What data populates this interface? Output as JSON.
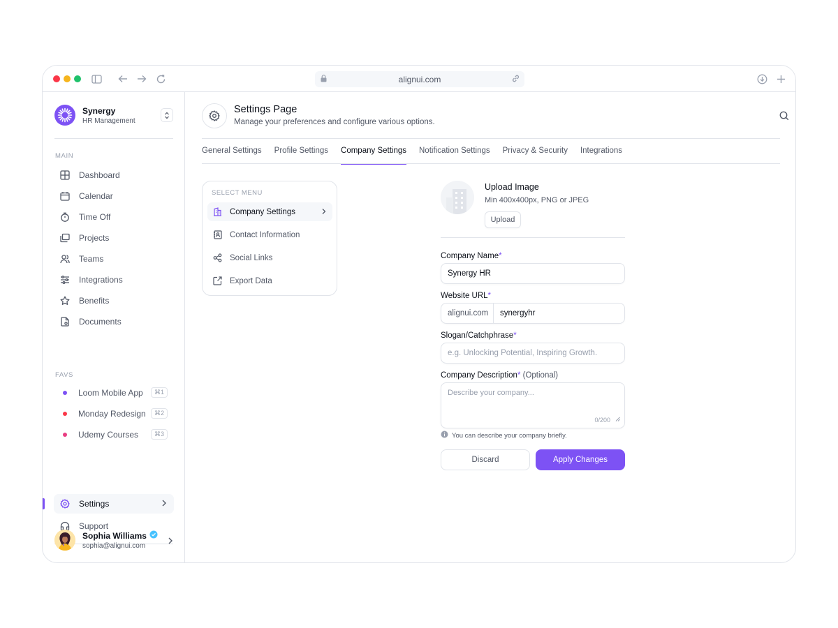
{
  "browser": {
    "url": "alignui.com"
  },
  "brand": {
    "name": "Synergy",
    "subtitle": "HR Management"
  },
  "sidebar": {
    "main_label": "MAIN",
    "items": [
      {
        "label": "Dashboard",
        "icon": "grid-icon"
      },
      {
        "label": "Calendar",
        "icon": "calendar-icon"
      },
      {
        "label": "Time Off",
        "icon": "timer-icon"
      },
      {
        "label": "Projects",
        "icon": "folders-icon"
      },
      {
        "label": "Teams",
        "icon": "users-icon"
      },
      {
        "label": "Integrations",
        "icon": "sliders-icon"
      },
      {
        "label": "Benefits",
        "icon": "star-icon"
      },
      {
        "label": "Documents",
        "icon": "document-icon"
      }
    ],
    "favs_label": "FAVS",
    "favs": [
      {
        "label": "Loom Mobile App",
        "shortcut": "⌘1",
        "color": "#7d52f4"
      },
      {
        "label": "Monday Redesign",
        "shortcut": "⌘2",
        "color": "#fb3748"
      },
      {
        "label": "Udemy Courses",
        "shortcut": "⌘3",
        "color": "#e93d82"
      }
    ],
    "settings_label": "Settings",
    "support_label": "Support"
  },
  "profile": {
    "name": "Sophia Williams",
    "email": "sophia@alignui.com"
  },
  "header": {
    "title": "Settings Page",
    "subtitle": "Manage your preferences and configure various options."
  },
  "tabs": [
    {
      "label": "General Settings"
    },
    {
      "label": "Profile Settings"
    },
    {
      "label": "Company Settings",
      "active": true
    },
    {
      "label": "Notification Settings"
    },
    {
      "label": "Privacy & Security"
    },
    {
      "label": "Integrations"
    }
  ],
  "menu": {
    "label": "SELECT MENU",
    "items": [
      {
        "label": "Company Settings"
      },
      {
        "label": "Contact Information"
      },
      {
        "label": "Social Links"
      },
      {
        "label": "Export Data"
      }
    ]
  },
  "form": {
    "upload_title": "Upload Image",
    "upload_sub": "Min 400x400px, PNG or JPEG",
    "upload_button": "Upload",
    "company_name_label": "Company Name",
    "company_name_value": "Synergy HR",
    "website_label": "Website URL",
    "website_prefix": "alignui.com",
    "website_value": "synergyhr",
    "slogan_label": "Slogan/Catchphrase",
    "slogan_placeholder": "e.g. Unlocking Potential, Inspiring Growth.",
    "description_label": "Company Description",
    "description_optional": "(Optional)",
    "description_placeholder": "Describe your company...",
    "description_counter": "0/200",
    "hint": "You can describe your company briefly.",
    "required_mark": "*",
    "discard": "Discard",
    "apply": "Apply Changes"
  },
  "colors": {
    "accent": "#7d52f4",
    "text": "#0e121b",
    "muted": "#525866",
    "border": "#e1e4ea"
  }
}
